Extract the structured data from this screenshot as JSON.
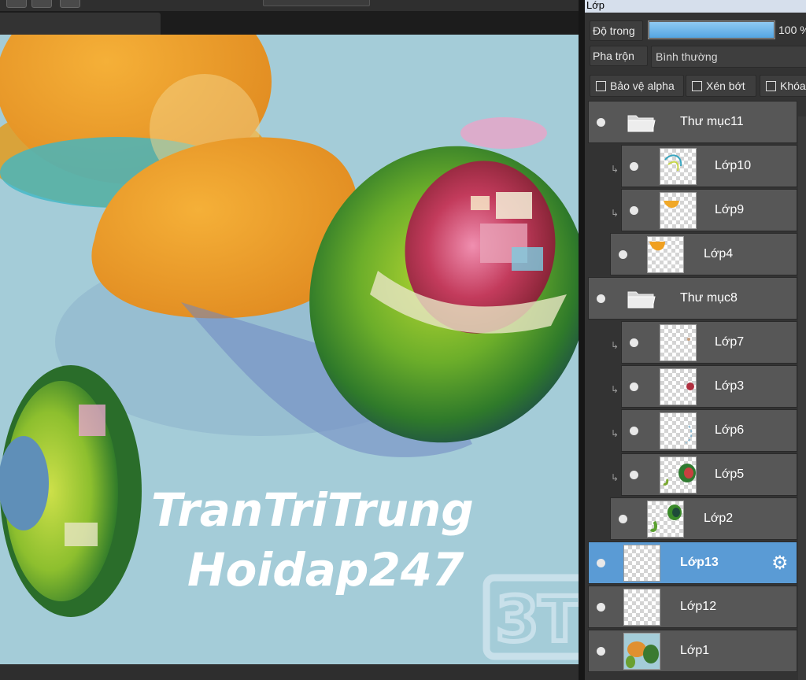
{
  "panel": {
    "title": "Lớp",
    "opacity_label": "Độ trong",
    "opacity_value": "100 %",
    "opacity_percent": 100,
    "blend_label": "Pha trộn",
    "blend_value": "Bình thường",
    "protect_alpha": "Bảo vệ alpha",
    "clipping": "Xén bớt",
    "lock": "Khóa"
  },
  "layers": [
    {
      "name": "Thư mục11",
      "type": "folder",
      "indent": 0,
      "clipped": false,
      "selected": false,
      "thumb": "folder"
    },
    {
      "name": "Lớp10",
      "type": "layer",
      "indent": 2,
      "clipped": true,
      "selected": false,
      "thumb": "lop10"
    },
    {
      "name": "Lớp9",
      "type": "layer",
      "indent": 2,
      "clipped": true,
      "selected": false,
      "thumb": "lop9"
    },
    {
      "name": "Lớp4",
      "type": "layer",
      "indent": 1,
      "clipped": false,
      "selected": false,
      "thumb": "lop4"
    },
    {
      "name": "Thư mục8",
      "type": "folder",
      "indent": 0,
      "clipped": false,
      "selected": false,
      "thumb": "folder"
    },
    {
      "name": "Lớp7",
      "type": "layer",
      "indent": 2,
      "clipped": true,
      "selected": false,
      "thumb": "lop7"
    },
    {
      "name": "Lớp3",
      "type": "layer",
      "indent": 2,
      "clipped": true,
      "selected": false,
      "thumb": "lop3"
    },
    {
      "name": "Lớp6",
      "type": "layer",
      "indent": 2,
      "clipped": true,
      "selected": false,
      "thumb": "lop6"
    },
    {
      "name": "Lớp5",
      "type": "layer",
      "indent": 2,
      "clipped": true,
      "selected": false,
      "thumb": "lop5"
    },
    {
      "name": "Lớp2",
      "type": "layer",
      "indent": 1,
      "clipped": false,
      "selected": false,
      "thumb": "lop2"
    },
    {
      "name": "Lớp13",
      "type": "layer",
      "indent": 0,
      "clipped": false,
      "selected": true,
      "thumb": "empty"
    },
    {
      "name": "Lớp12",
      "type": "layer",
      "indent": 0,
      "clipped": false,
      "selected": false,
      "thumb": "empty"
    },
    {
      "name": "Lớp1",
      "type": "layer",
      "indent": 0,
      "clipped": false,
      "selected": false,
      "thumb": "lop1"
    }
  ],
  "canvas": {
    "line1": "TranTriTrung",
    "line2": "Hoidap247",
    "watermark": "3T"
  },
  "colors": {
    "canvas_bg": "#a4ccd8",
    "panel_bg": "#333333",
    "row_bg": "#575757",
    "selected_row": "#5a9bd5",
    "accent": "#55a6e2"
  }
}
